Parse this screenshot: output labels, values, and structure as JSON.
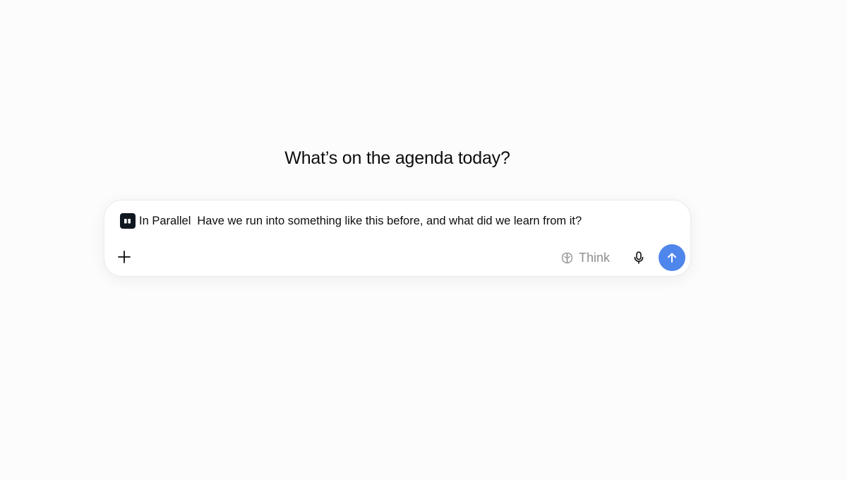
{
  "main": {
    "heading": "What’s on the agenda today?"
  },
  "composer": {
    "app_chip": {
      "name": "In Parallel",
      "icon": "in-parallel-app-icon"
    },
    "prompt_text": "Have we run into something like this before, and what did we learn from it?",
    "think_label": "Think",
    "icons": {
      "add": "plus-icon",
      "think": "brain-icon",
      "voice": "microphone-icon",
      "send": "arrow-up-icon"
    }
  },
  "colors": {
    "background": "#fcfcfc",
    "send_button": "#4f86ec",
    "app_icon": "#0f1720",
    "think_label": "#8f8f8f"
  }
}
